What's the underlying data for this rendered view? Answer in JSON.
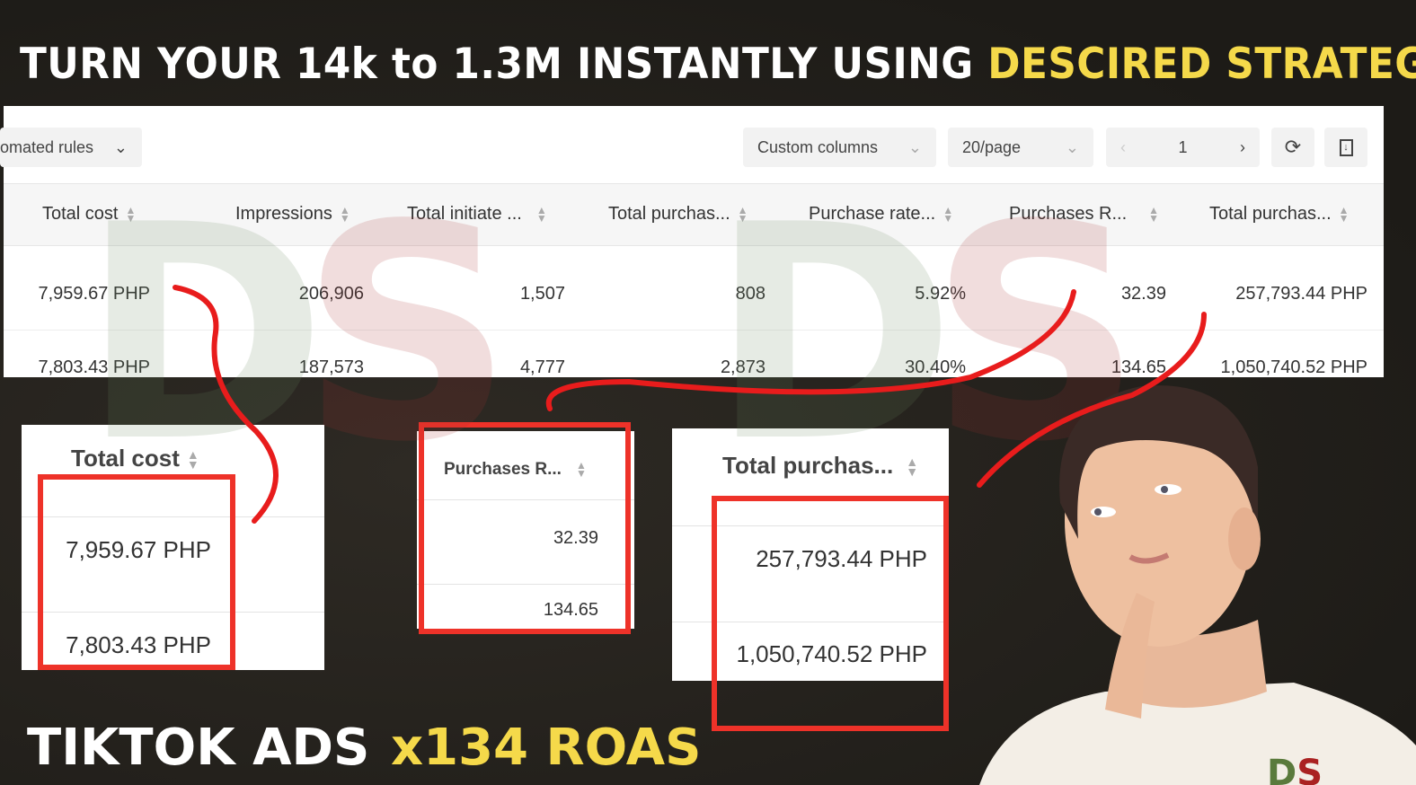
{
  "headline": {
    "part1": "TURN YOUR 14k to 1.3M INSTANTLY USING ",
    "part2": "DESCIRED  STRATEGY"
  },
  "toolbar": {
    "automated_rules": "omated rules",
    "custom_columns": "Custom columns",
    "page_size": "20/page",
    "page_number": "1"
  },
  "table": {
    "columns": [
      "Total cost",
      "Impressions",
      "Total initiate ...",
      "Total purchas...",
      "Purchase rate...",
      "Purchases R...",
      "Total purchas..."
    ],
    "rows": [
      [
        "7,959.67 PHP",
        "206,906",
        "1,507",
        "808",
        "5.92%",
        "32.39",
        "257,793.44 PHP"
      ],
      [
        "7,803.43 PHP",
        "187,573",
        "4,777",
        "2,873",
        "30.40%",
        "134.65",
        "1,050,740.52 PHP"
      ]
    ]
  },
  "zoom_cards": [
    {
      "header": "Total cost",
      "values": [
        "7,959.67 PHP",
        "7,803.43 PHP"
      ]
    },
    {
      "header": "Purchases R...",
      "values": [
        "32.39",
        "134.65"
      ]
    },
    {
      "header": "Total purchas...",
      "values": [
        "257,793.44 PHP",
        "1,050,740.52 PHP"
      ]
    }
  ],
  "footer": {
    "left": "TIKTOK ADS",
    "right": "x134 ROAS"
  },
  "watermark": "DS",
  "colors": {
    "accent_yellow": "#f5d94a",
    "highlight_red": "#ee3229",
    "background": "#25221d"
  }
}
